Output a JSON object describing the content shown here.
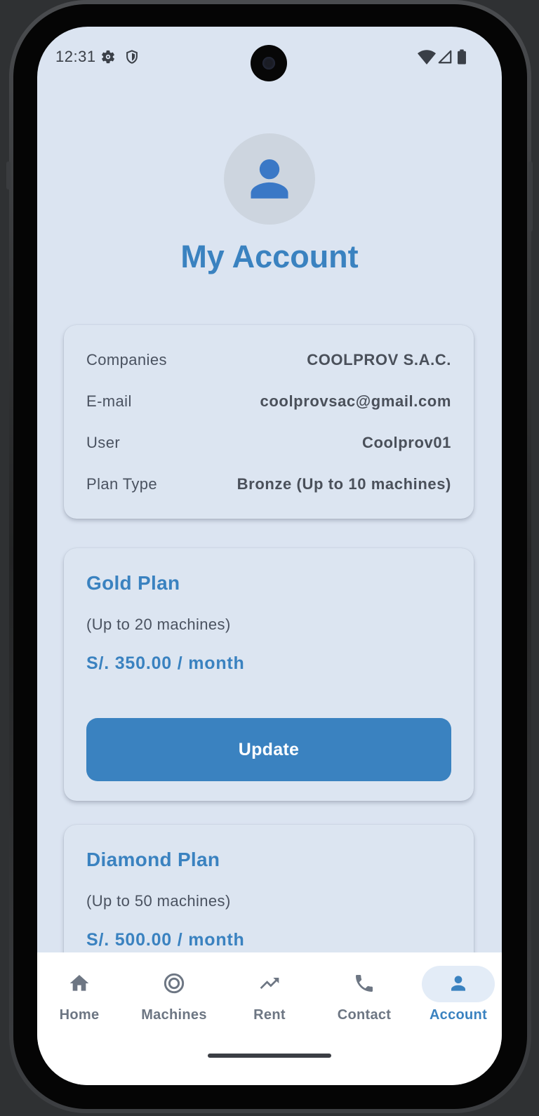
{
  "status_bar": {
    "time": "12:31",
    "left_icons": [
      "gear-icon",
      "shield-icon"
    ],
    "right_icons": [
      "wifi-icon",
      "signal-icon",
      "battery-icon"
    ]
  },
  "header": {
    "avatar_icon": "person-icon",
    "title": "My Account"
  },
  "account_info": {
    "rows": [
      {
        "label": "Companies",
        "value": "COOLPROV S.A.C."
      },
      {
        "label": "E-mail",
        "value": "coolprovsac@gmail.com"
      },
      {
        "label": "User",
        "value": "Coolprov01"
      },
      {
        "label": "Plan Type",
        "value": "Bronze (Up to 10 machines)"
      }
    ]
  },
  "plans": [
    {
      "title": "Gold Plan",
      "description": "(Up to 20 machines)",
      "price": "S/. 350.00 / month",
      "button_label": "Update"
    },
    {
      "title": "Diamond Plan",
      "description": "(Up to 50 machines)",
      "price": "S/. 500.00 / month"
    }
  ],
  "bottom_nav": {
    "items": [
      {
        "label": "Home",
        "icon": "home-icon",
        "active": false
      },
      {
        "label": "Machines",
        "icon": "target-icon",
        "active": false
      },
      {
        "label": "Rent",
        "icon": "trending-up-icon",
        "active": false
      },
      {
        "label": "Contact",
        "icon": "phone-icon",
        "active": false
      },
      {
        "label": "Account",
        "icon": "person-icon",
        "active": true
      }
    ]
  },
  "colors": {
    "accent": "#3a82c0",
    "background": "#dbe4f1",
    "nav_inactive": "#6d7683"
  }
}
